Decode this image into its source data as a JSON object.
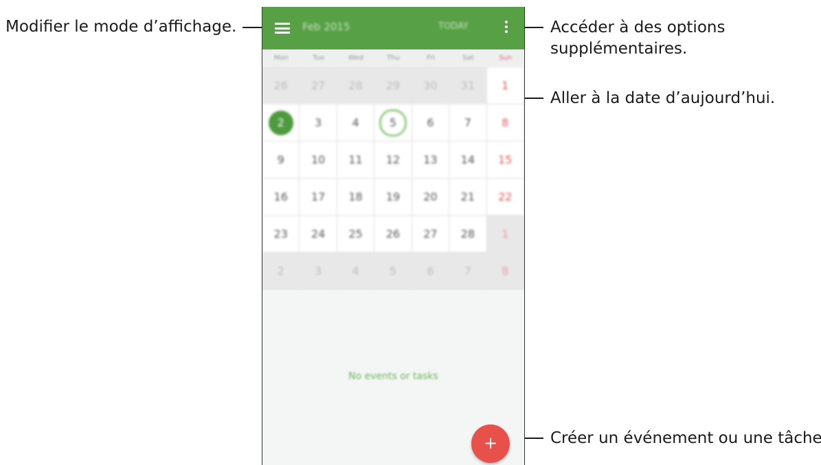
{
  "annotations": {
    "view_mode": "Modifier le mode d’affichage.",
    "more_options_line1": "Accéder à des options",
    "more_options_line2": "supplémentaires.",
    "today": "Aller à la date d’aujourd’hui.",
    "create": "Créer un événement ou une tâche."
  },
  "appbar": {
    "title": "Feb 2015",
    "today_label": "TODAY",
    "menu_icon": "hamburger-menu-icon",
    "more_icon": "more-vertical-icon",
    "color": "#57a045"
  },
  "weekdays": [
    "Mon",
    "Tue",
    "Wed",
    "Thu",
    "Fri",
    "Sat",
    "Sun"
  ],
  "weeks": [
    [
      "26",
      "27",
      "28",
      "29",
      "30",
      "31",
      "1"
    ],
    [
      "2",
      "3",
      "4",
      "5",
      "6",
      "7",
      "8"
    ],
    [
      "9",
      "10",
      "11",
      "12",
      "13",
      "14",
      "15"
    ],
    [
      "16",
      "17",
      "18",
      "19",
      "20",
      "21",
      "22"
    ],
    [
      "23",
      "24",
      "25",
      "26",
      "27",
      "28",
      "1"
    ],
    [
      "2",
      "3",
      "4",
      "5",
      "6",
      "7",
      "8"
    ]
  ],
  "empty_state": "No events or tasks",
  "fab": {
    "label": "+",
    "color": "#e8514b"
  }
}
